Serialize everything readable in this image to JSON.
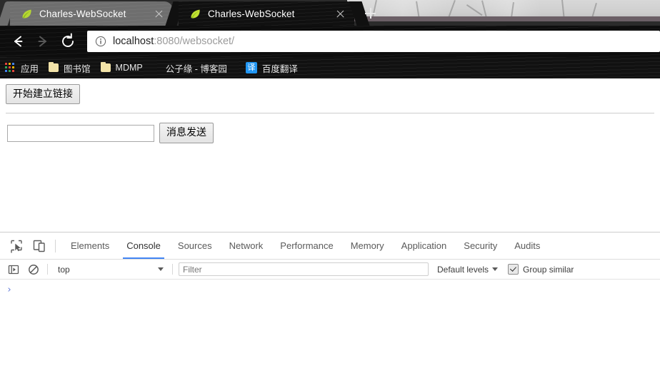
{
  "browser": {
    "tabs": [
      {
        "title": "Charles-WebSocket",
        "favicon": "leaf-icon",
        "active": false,
        "close_label": "×"
      },
      {
        "title": "Charles-WebSocket",
        "favicon": "leaf-icon",
        "active": true,
        "close_label": "×"
      }
    ],
    "new_tab_label": "+",
    "nav": {
      "back_label": "←",
      "forward_label": "→",
      "reload_label": "⟳"
    },
    "omnibox": {
      "info_icon": "info-circle-icon",
      "url_host": "localhost",
      "url_rest": ":8080/websocket/",
      "full_url": "localhost:8080/websocket/"
    },
    "bookmarks": [
      {
        "label": "应用",
        "icon": "apps-grid-icon"
      },
      {
        "label": "图书馆",
        "icon": "folder-icon"
      },
      {
        "label": "MDMP",
        "icon": "folder-icon"
      },
      {
        "label": "公子缘 - 博客园",
        "icon": "none"
      },
      {
        "label": "百度翻译",
        "icon": "translate-icon",
        "icon_text": "译"
      }
    ]
  },
  "page": {
    "connect_button": "开始建立链接",
    "message_input_value": "",
    "message_input_placeholder": "",
    "send_button": "消息发送"
  },
  "devtools": {
    "inspect_icon": "inspect-cursor-icon",
    "device_icon": "device-toolbar-icon",
    "tabs": [
      {
        "label": "Elements",
        "active": false
      },
      {
        "label": "Console",
        "active": true
      },
      {
        "label": "Sources",
        "active": false
      },
      {
        "label": "Network",
        "active": false
      },
      {
        "label": "Performance",
        "active": false
      },
      {
        "label": "Memory",
        "active": false
      },
      {
        "label": "Application",
        "active": false
      },
      {
        "label": "Security",
        "active": false
      },
      {
        "label": "Audits",
        "active": false
      }
    ],
    "console": {
      "sidebar_icon": "console-sidebar-icon",
      "clear_icon": "clear-console-icon",
      "context": "top",
      "filter_placeholder": "Filter",
      "filter_value": "",
      "levels_label": "Default levels",
      "group_similar_label": "Group similar",
      "group_similar_checked": true,
      "prompt_symbol": "›"
    }
  },
  "colors": {
    "accent_blue": "#4285f4",
    "prompt_blue": "#6078d8",
    "translate_blue": "#2196f3",
    "folder_yellow": "#f2e3a8"
  }
}
